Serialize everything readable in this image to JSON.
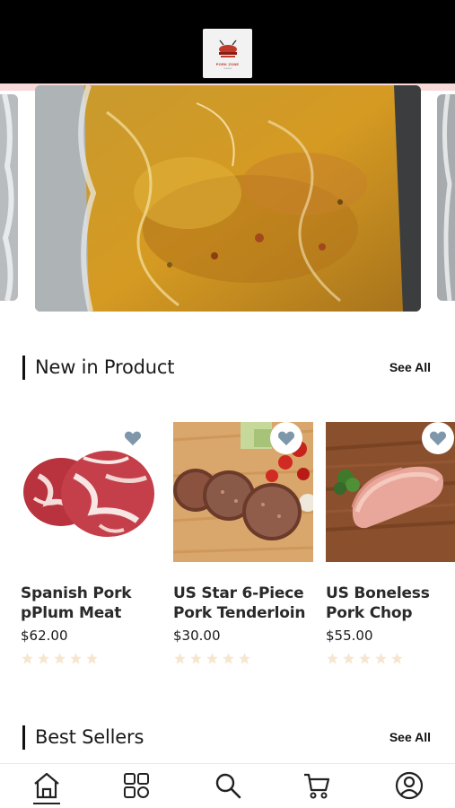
{
  "header": {
    "logo_icon": "butcher-logo-icon",
    "logo_text": "PORK ZONE",
    "logo_sub": "market"
  },
  "carousel": {
    "slides": [
      "left-partial-slide",
      "main-slide",
      "right-partial-slide"
    ]
  },
  "new_products": {
    "title": "New in Product",
    "see_all": "See All",
    "items": [
      {
        "name_line1": "Spanish Pork",
        "name_line2": "pPlum Meat",
        "price": "$62.00",
        "rating": 0
      },
      {
        "name_line1": "US Star 6-Piece",
        "name_line2": "Pork Tenderloin",
        "price": "$30.00",
        "rating": 0
      },
      {
        "name_line1": "US Boneless",
        "name_line2": "Pork Chop",
        "price": "$55.00",
        "rating": 0
      }
    ]
  },
  "best_sellers": {
    "title": "Best Sellers",
    "see_all": "See All"
  },
  "tabbar": {
    "items": [
      "home-icon",
      "categories-icon",
      "search-icon",
      "cart-icon",
      "profile-icon"
    ],
    "active": "home-icon"
  },
  "colors": {
    "star_empty": "#f6e6cf",
    "fav_heart": "#7f97aa",
    "accent_dark": "#111111"
  }
}
